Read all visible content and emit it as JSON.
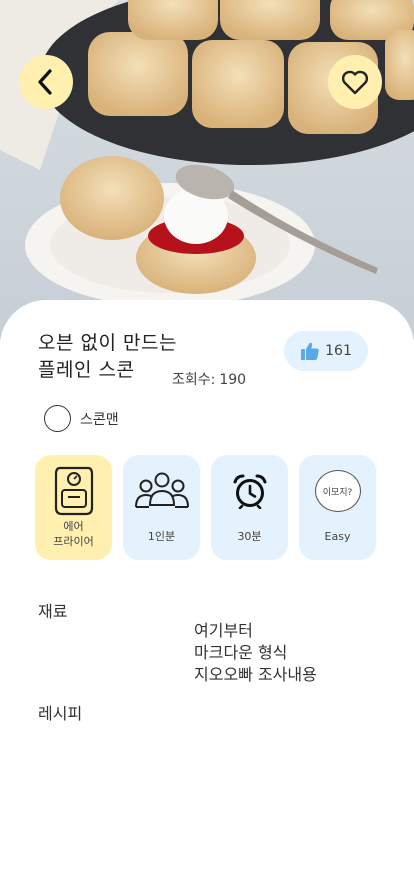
{
  "recipe": {
    "title_line1": "오븐 없이 만드는",
    "title_line2": "플레인 스콘",
    "views_label": "조회수:",
    "views_count": "190",
    "likes": "161",
    "author": "스콘맨"
  },
  "info_tiles": [
    {
      "label": "에어\n프라이어",
      "icon": "air-fryer-icon"
    },
    {
      "label": "1인분",
      "icon": "people-icon"
    },
    {
      "label": "30분",
      "icon": "alarm-clock-icon"
    },
    {
      "label": "Easy",
      "icon_text": "이모지?"
    }
  ],
  "ingredients_title": "재료",
  "ingredients": [
    "여기부터",
    "마크다운 형식",
    "지오오빠 조사내용"
  ],
  "recipe_title": "레시피",
  "colors": {
    "accent_yellow": "#fff0b0",
    "accent_blue": "#e4f2fd",
    "like_icon": "#5aa9e6"
  }
}
